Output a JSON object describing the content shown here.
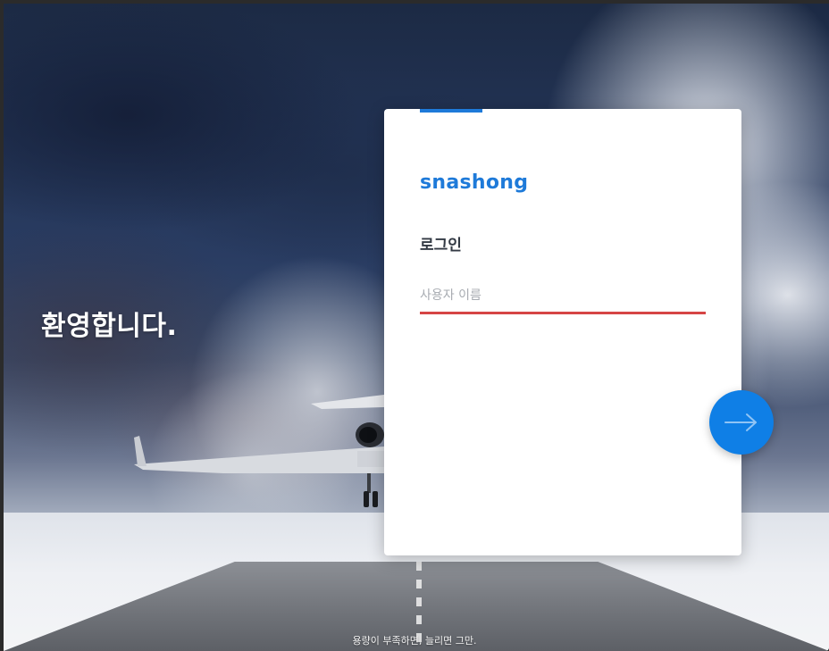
{
  "welcome": {
    "heading": "환영합니다."
  },
  "login_card": {
    "brand": "snashong",
    "title": "로그인",
    "username_placeholder": "사용자 이름",
    "username_value": ""
  },
  "next_button": {
    "icon": "arrow-right-icon"
  },
  "footer": {
    "text": "용량이 부족하면, 늘리면 그만."
  },
  "colors": {
    "accent": "#1e7ad9",
    "button": "#0f7fe6",
    "error_underline": "#d64545"
  }
}
